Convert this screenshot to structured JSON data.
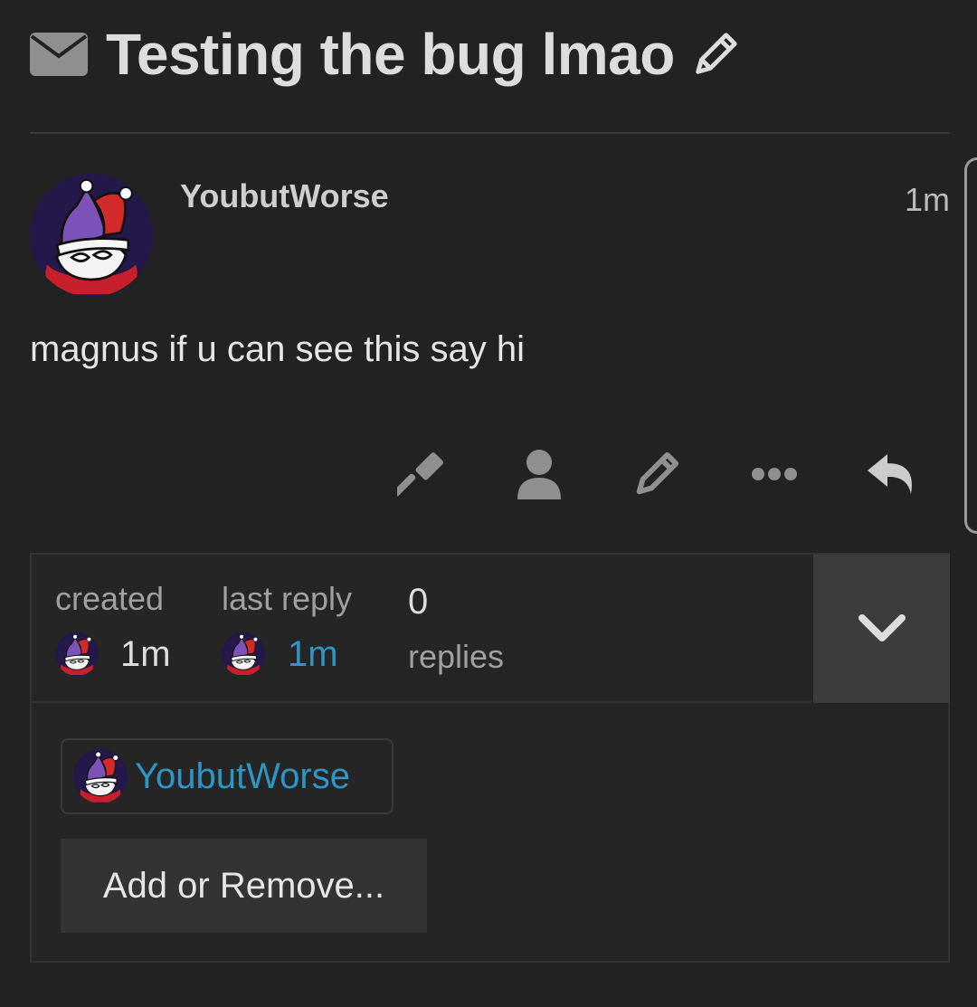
{
  "topic": {
    "title": "Testing the bug lmao",
    "title_icon": "envelope-icon",
    "edit_icon": "pencil-icon"
  },
  "post": {
    "username": "YoubutWorse",
    "age": "1m",
    "body": "magnus if u can see this say hi",
    "actions": [
      {
        "name": "admin-gavel-icon"
      },
      {
        "name": "user-icon"
      },
      {
        "name": "pencil-icon"
      },
      {
        "name": "more-ellipsis-icon"
      },
      {
        "name": "reply-icon"
      }
    ]
  },
  "summary": {
    "created_label": "created",
    "created_age": "1m",
    "last_reply_label": "last reply",
    "last_reply_age": "1m",
    "replies_count": "0",
    "replies_label": "replies",
    "participant_name": "YoubutWorse",
    "add_remove_label": "Add or Remove..."
  },
  "colors": {
    "background": "#222222",
    "link": "#2e95c4",
    "icon": "#8f8f8f"
  }
}
